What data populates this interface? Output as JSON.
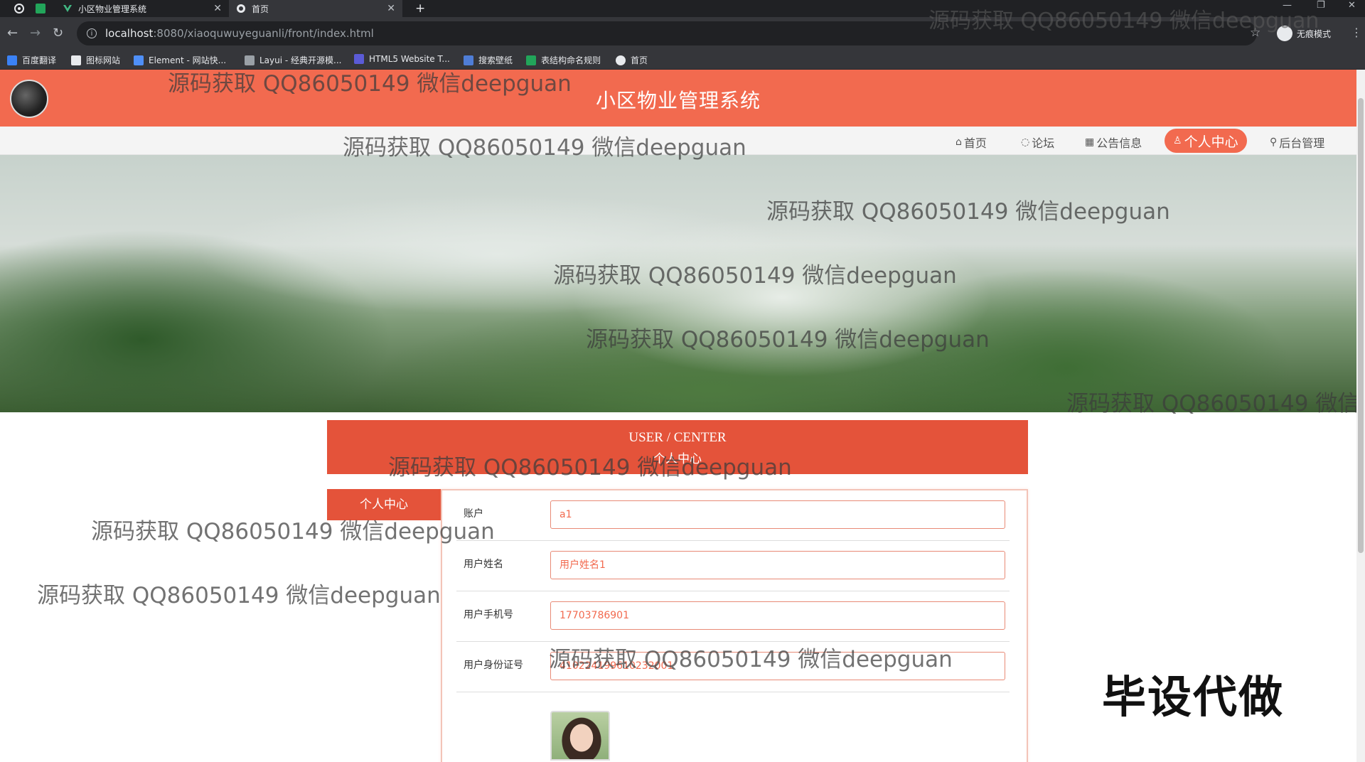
{
  "browser": {
    "tabs": [
      {
        "title": "小区物业管理系统",
        "active": false
      },
      {
        "title": "首页",
        "active": true
      }
    ],
    "new_tab_glyph": "+",
    "url_host": "localhost",
    "url_path": ":8080/xiaoquwuyeguanli/front/index.html",
    "incognito_label": "无痕模式",
    "bookmarks": [
      {
        "label": "百度翻译",
        "color": "#3b82f6"
      },
      {
        "label": "图标网站",
        "color": "#e8eaed"
      },
      {
        "label": "Element - 网站快...",
        "color": "#4f8ff7"
      },
      {
        "label": "Layui - 经典开源模...",
        "color": "#9aa0a6"
      },
      {
        "label": "HTML5 Website T...",
        "color": "#5b5bd6"
      },
      {
        "label": "搜索壁纸",
        "color": "#4f7dd6"
      },
      {
        "label": "表结构命名规则",
        "color": "#22a55a"
      },
      {
        "label": "首页",
        "color": "#e8eaed"
      }
    ]
  },
  "site": {
    "title": "小区物业管理系统",
    "accent": "#f26a4f",
    "nav": [
      {
        "label": "首页",
        "icon": "home-icon",
        "active": false
      },
      {
        "label": "论坛",
        "icon": "forum-icon",
        "active": false
      },
      {
        "label": "公告信息",
        "icon": "notice-icon",
        "active": false
      },
      {
        "label": "个人中心",
        "icon": "user-icon",
        "active": true
      },
      {
        "label": "后台管理",
        "icon": "link-icon",
        "active": false
      }
    ],
    "carousel": {
      "slides": 3,
      "active": 0
    }
  },
  "user_center": {
    "heading_en": "USER / CENTER",
    "heading_cn": "个人中心",
    "side_tab": "个人中心",
    "fields": [
      {
        "label": "账户",
        "value": "a1"
      },
      {
        "label": "用户姓名",
        "value": "用户姓名1"
      },
      {
        "label": "用户手机号",
        "value": "17703786901"
      },
      {
        "label": "用户身份证号",
        "value": "410224199610232001"
      }
    ]
  },
  "watermark_text": "源码获取 QQ86050149 微信deepguan",
  "promo_text": "毕设代做"
}
